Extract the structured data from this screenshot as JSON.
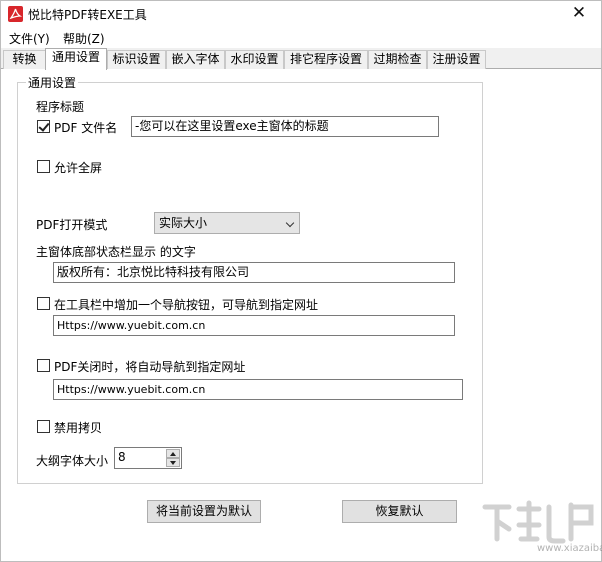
{
  "window": {
    "title": "悦比特PDF转EXE工具"
  },
  "menu": {
    "items": [
      "文件(Y)",
      "帮助(Z)"
    ]
  },
  "tabs": [
    "转换",
    "通用设置",
    "标识设置",
    "嵌入字体",
    "水印设置",
    "排它程序设置",
    "过期检查",
    "注册设置"
  ],
  "active_tab": "通用设置",
  "general": {
    "group_title": "通用设置",
    "program_title_label": "程序标题",
    "pdf_filename": {
      "label": "PDF 文件名",
      "checked": true
    },
    "title_value": "-您可以在这里设置exe主窗体的标题",
    "fullscreen": {
      "label": "允许全屏",
      "checked": false
    },
    "open_mode_label": "PDF打开模式",
    "open_mode_value": "实际大小",
    "statusbar_label": "主窗体底部状态栏显示 的文字",
    "statusbar_value": "版权所有：北京悦比特科技有限公司",
    "nav_button": {
      "label": "在工具栏中增加一个导航按钮，可导航到指定网址",
      "checked": false
    },
    "nav_url": "Https://www.yuebit.com.cn",
    "close_nav": {
      "label": "PDF关闭时，将自动导航到指定网址",
      "checked": false
    },
    "close_url": "Https://www.yuebit.com.cn",
    "disable_copy": {
      "label": "禁用拷贝",
      "checked": false
    },
    "outline_font_label": "大纲字体大小",
    "outline_font_size": "8"
  },
  "buttons": {
    "set_default": "将当前设置为默认",
    "restore_default": "恢复默认"
  },
  "watermark": {
    "site": "www.xiazaiba.com"
  }
}
